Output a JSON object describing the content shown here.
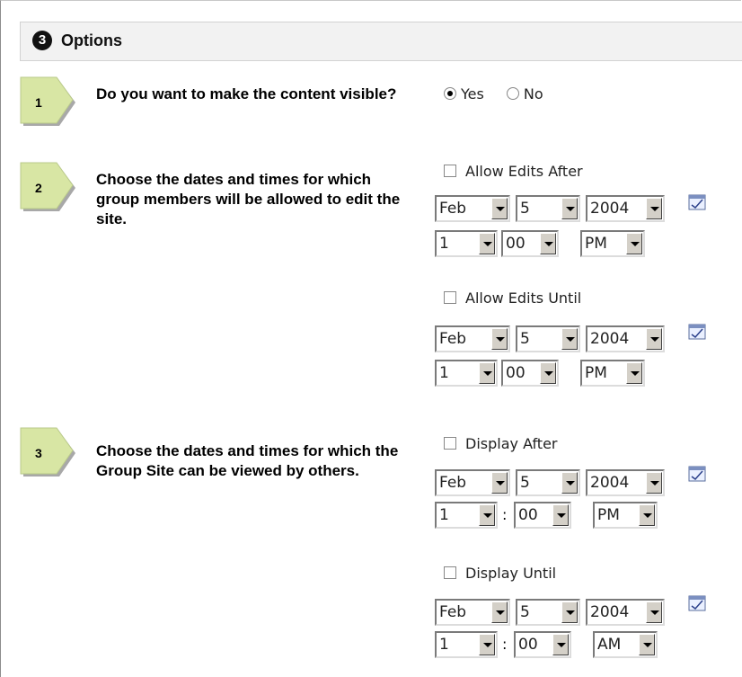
{
  "header": {
    "number": "3",
    "title": "Options"
  },
  "steps": [
    {
      "number": "1",
      "question": "Do you want to make the content visible?"
    },
    {
      "number": "2",
      "question": "Choose the dates and times for which group members will be allowed to edit the site."
    },
    {
      "number": "3",
      "question": "Choose the dates and times for which the Group Site can be viewed by others."
    }
  ],
  "visibility": {
    "yes_label": "Yes",
    "no_label": "No",
    "selected": "Yes"
  },
  "groups": [
    {
      "label": "Allow Edits After",
      "month": "Feb",
      "day": "5",
      "year": "2004",
      "hour": "1",
      "minute": "00",
      "ampm": "PM",
      "colon": ""
    },
    {
      "label": "Allow Edits Until",
      "month": "Feb",
      "day": "5",
      "year": "2004",
      "hour": "1",
      "minute": "00",
      "ampm": "PM",
      "colon": ""
    },
    {
      "label": "Display After",
      "month": "Feb",
      "day": "5",
      "year": "2004",
      "hour": "1",
      "minute": "00",
      "ampm": "PM",
      "colon": ":"
    },
    {
      "label": "Display Until",
      "month": "Feb",
      "day": "5",
      "year": "2004",
      "hour": "1",
      "minute": "00",
      "ampm": "AM",
      "colon": ":"
    }
  ],
  "icons": {
    "step_arrow": "step-arrow-icon",
    "calendar": "calendar-icon",
    "header_badge": "number-badge-icon"
  },
  "colors": {
    "step_fill": "#d8e6a4",
    "header_bg": "#f2f2f2"
  }
}
